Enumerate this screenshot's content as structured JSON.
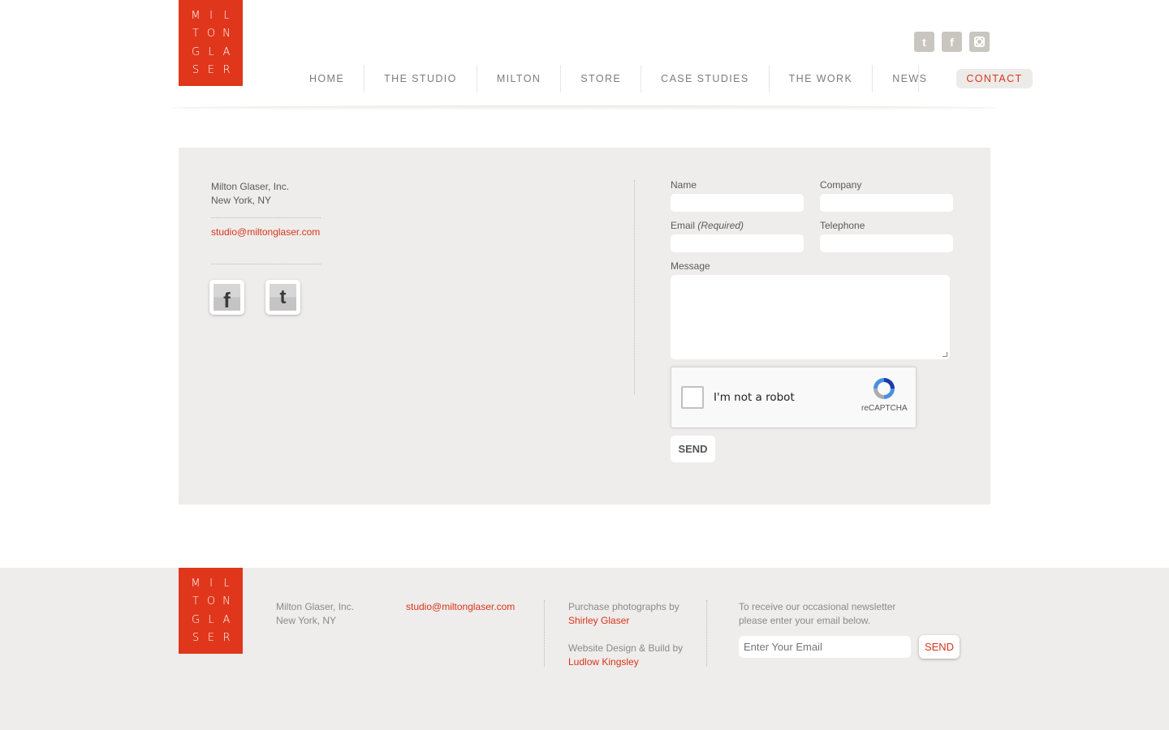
{
  "logo": {
    "letters": [
      "M",
      "I",
      "L",
      "T",
      "O",
      "N",
      "G",
      "L",
      "A",
      "S",
      "E",
      "R"
    ]
  },
  "social_top": {
    "twitter": "t",
    "facebook": "f"
  },
  "nav": {
    "items": [
      "HOME",
      "THE STUDIO",
      "MILTON",
      "STORE",
      "CASE STUDIES",
      "THE WORK",
      "NEWS"
    ],
    "active": "CONTACT"
  },
  "contact": {
    "company": "Milton Glaser, Inc.",
    "city": "New York, NY",
    "email": "studio@miltonglaser.com",
    "facebook_glyph": "f",
    "twitter_glyph": "t"
  },
  "form": {
    "name_label": "Name",
    "company_label": "Company",
    "email_label": "Email",
    "email_required": "(Required)",
    "telephone_label": "Telephone",
    "message_label": "Message",
    "captcha_text": "I'm not a robot",
    "captcha_brand": "reCAPTCHA",
    "send_label": "SEND"
  },
  "footer": {
    "company": "Milton Glaser, Inc.",
    "city": "New York, NY",
    "email": "studio@miltonglaser.com",
    "photo_text": "Purchase photographs by",
    "photo_credit": "Shirley Glaser",
    "design_text": "Website Design & Build by",
    "design_credit": "Ludlow Kingsley",
    "newsletter_line1": "To receive our occasional newsletter",
    "newsletter_line2": "please enter your email below.",
    "email_placeholder": "Enter Your Email",
    "send_label": "SEND"
  },
  "colors": {
    "accent": "#d8341b",
    "logo_bg": "#e0361b",
    "panel_bg": "#eeedeb"
  }
}
